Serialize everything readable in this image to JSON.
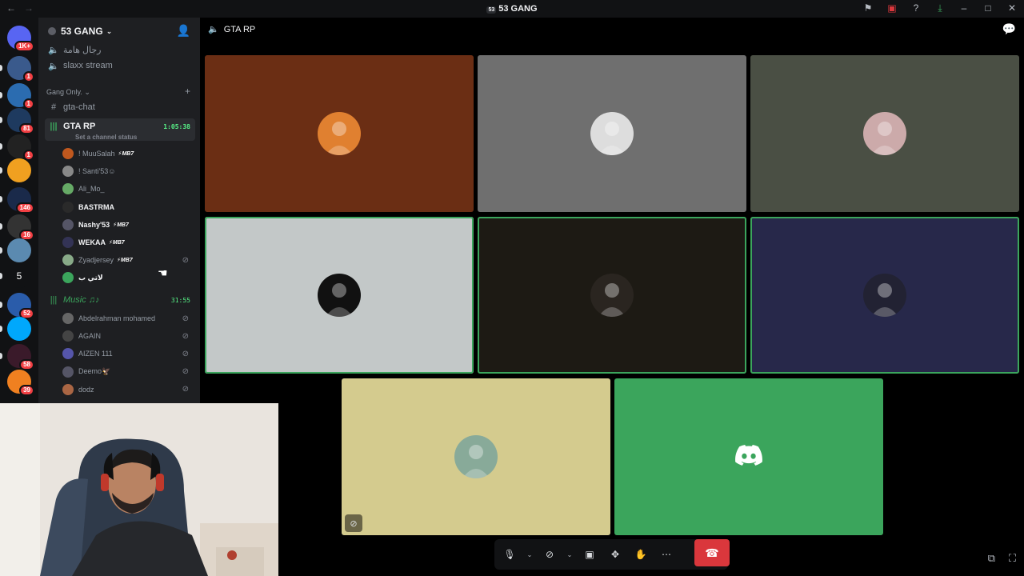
{
  "titlebar": {
    "title": "53 GANG",
    "title_icon": "53"
  },
  "servers": [
    {
      "badge": "1K+",
      "color": "#5865f2"
    },
    {
      "badge": "1",
      "color": "#3a5a8c"
    },
    {
      "badge": "1",
      "color": "#2b6cb0"
    },
    {
      "badge": "81",
      "color": "#1e3a5f"
    },
    {
      "badge": "1",
      "color": "#222"
    },
    {
      "badge": "",
      "color": "#f0a020"
    },
    {
      "badge": "146",
      "color": "#1a2a4a"
    },
    {
      "badge": "16",
      "color": "#333"
    },
    {
      "badge": "",
      "color": "#5b8ab0"
    },
    {
      "badge": "",
      "label": "5",
      "color": "#111214"
    },
    {
      "badge": "52",
      "color": "#2a5caa"
    },
    {
      "badge": "",
      "color": "#00a8fc"
    },
    {
      "badge": "58",
      "color": "#3a1a2a"
    },
    {
      "badge": "39",
      "color": "#f08020"
    }
  ],
  "sidebar": {
    "guild_name": "53 GANG",
    "channels_top": [
      {
        "name": "رجال هامة",
        "icon": "speaker-icon"
      },
      {
        "name": "slaxx stream",
        "icon": "speaker-icon"
      }
    ],
    "category": "Gang Only.",
    "text_channel": "gta-chat",
    "voice_channel": {
      "name": "GTA RP",
      "time": "1:05:38",
      "status": "Set a channel status"
    },
    "members": [
      {
        "name": "! MuuSalah",
        "tag": "⚡MB7",
        "color": "#c0581e",
        "bright": false
      },
      {
        "name": "! Santi'53☺",
        "tag": "",
        "color": "#888",
        "bright": false
      },
      {
        "name": "Ali_Mo_",
        "tag": "",
        "color": "#6a6",
        "bright": false
      },
      {
        "name": "BASTRMA",
        "tag": "",
        "color": "#2a2a2a",
        "bright": true
      },
      {
        "name": "Nashy'53",
        "tag": "⚡MB7",
        "color": "#556",
        "bright": true
      },
      {
        "name": "WEKAA",
        "tag": "⚡MB7",
        "color": "#335",
        "bright": true
      },
      {
        "name": "Zyadjersey",
        "tag": "⚡MB7",
        "color": "#8a8",
        "bright": false,
        "muted": true
      },
      {
        "name": "لاتي ب",
        "tag": "",
        "color": "#3ba55c",
        "bright": true
      }
    ],
    "music_channel": {
      "name": "Music ♫♪",
      "time": "31:55"
    },
    "music_members": [
      {
        "name": "Abdelrahman mohamed",
        "color": "#666"
      },
      {
        "name": "AGAIN",
        "color": "#444"
      },
      {
        "name": "AIZEN 111",
        "color": "#55a"
      },
      {
        "name": "Deemo🦅",
        "color": "#556"
      },
      {
        "name": "dodz",
        "color": "#a64"
      }
    ]
  },
  "stage": {
    "channel_name": "GTA RP",
    "tiles": [
      {
        "bg": "#6b2e14",
        "speaking": false,
        "pfp": "#e08030"
      },
      {
        "bg": "#6f6f6f",
        "speaking": false,
        "pfp": "#ddd"
      },
      {
        "bg": "#4a4f44",
        "speaking": false,
        "pfp": "#caa"
      },
      {
        "bg": "#c3c8c8",
        "speaking": true,
        "pfp": "#111"
      },
      {
        "bg": "#1d1a14",
        "speaking": true,
        "pfp": "#2a2520"
      },
      {
        "bg": "#27284a",
        "speaking": true,
        "pfp": "#223"
      },
      {
        "bg": "#d4cb8e",
        "speaking": false,
        "pfp": "#8a9",
        "muted": true
      },
      {
        "bg": "#3ba55c",
        "speaking": false,
        "pfp": "discord"
      }
    ]
  },
  "colors": {
    "accent_green": "#3ba55c",
    "hangup_red": "#da373c",
    "sidebar_bg": "#1e1f22",
    "rail_bg": "#111214"
  }
}
